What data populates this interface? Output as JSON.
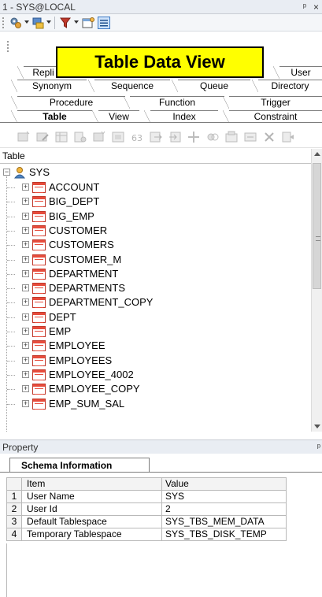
{
  "panel": {
    "title": "1 - SYS@LOCAL",
    "pin": "ᵖ",
    "close": "×"
  },
  "banner": {
    "text": "Table Data View"
  },
  "tabs": {
    "row1": [
      "Repli",
      "User"
    ],
    "row2": [
      "Synonym",
      "Sequence",
      "Queue",
      "Directory"
    ],
    "row3": [
      "Procedure",
      "Function",
      "Trigger"
    ],
    "row4": [
      "Table",
      "View",
      "Index",
      "Constraint"
    ],
    "active": "Table"
  },
  "tree": {
    "header": "Table",
    "root": "SYS",
    "items": [
      "ACCOUNT",
      "BIG_DEPT",
      "BIG_EMP",
      "CUSTOMER",
      "CUSTOMERS",
      "CUSTOMER_M",
      "DEPARTMENT",
      "DEPARTMENTS",
      "DEPARTMENT_COPY",
      "DEPT",
      "EMP",
      "EMPLOYEE",
      "EMPLOYEES",
      "EMPLOYEE_4002",
      "EMPLOYEE_COPY",
      "EMP_SUM_SAL"
    ]
  },
  "property": {
    "title": "Property",
    "tab": "Schema Information",
    "columns": [
      "Item",
      "Value"
    ],
    "rows": [
      {
        "n": "1",
        "item": "User Name",
        "value": "SYS"
      },
      {
        "n": "2",
        "item": "User Id",
        "value": "2"
      },
      {
        "n": "3",
        "item": "Default Tablespace",
        "value": "SYS_TBS_MEM_DATA"
      },
      {
        "n": "4",
        "item": "Temporary Tablespace",
        "value": "SYS_TBS_DISK_TEMP"
      }
    ]
  },
  "colors": {
    "banner_bg": "#ffff00",
    "table_icon": "#e74c3c"
  }
}
